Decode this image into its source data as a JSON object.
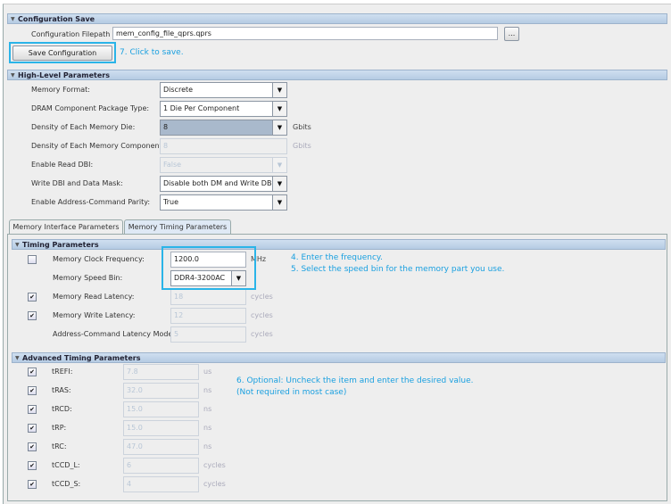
{
  "config_save": {
    "header": "Configuration Save",
    "filepath_label": "Configuration Filepath :",
    "filepath_value": "mem_config_file_qprs.qprs",
    "browse_label": "...",
    "save_button": "Save Configuration",
    "note": "7. Click to save."
  },
  "high_level": {
    "header": "High-Level Parameters",
    "rows": [
      {
        "label": "Memory Format:",
        "value": "Discrete",
        "unit": ""
      },
      {
        "label": "DRAM Component Package Type:",
        "value": "1 Die Per Component",
        "unit": ""
      },
      {
        "label": "Density of Each Memory Die:",
        "value": "8",
        "unit": "Gbits"
      },
      {
        "label": "Density of Each Memory Component :",
        "value": "8",
        "unit": "Gbits"
      },
      {
        "label": "Enable Read DBI:",
        "value": "False",
        "unit": ""
      },
      {
        "label": "Write DBI and Data Mask:",
        "value": "Disable both DM and Write DBI",
        "unit": ""
      },
      {
        "label": "Enable Address-Command Parity:",
        "value": "True",
        "unit": ""
      }
    ]
  },
  "tabs": [
    "Memory Interface Parameters",
    "Memory Timing Parameters"
  ],
  "timing": {
    "header": "Timing Parameters",
    "rows": [
      {
        "label": "Memory Clock Frequency:",
        "value": "1200.0",
        "unit": "MHz",
        "checked": false
      },
      {
        "label": "Memory Speed Bin:",
        "value": "DDR4-3200AC",
        "unit": ""
      },
      {
        "label": "Memory Read Latency:",
        "value": "18",
        "unit": "cycles",
        "checked": true
      },
      {
        "label": "Memory Write Latency:",
        "value": "12",
        "unit": "cycles",
        "checked": true
      },
      {
        "label": "Address-Command Latency Mode:",
        "value": "5",
        "unit": "cycles"
      }
    ],
    "note1": "4. Enter the frequency.",
    "note2": "5. Select the speed bin for the memory part you use."
  },
  "advanced": {
    "header": "Advanced Timing Parameters",
    "rows": [
      {
        "label": "tREFI:",
        "value": "7.8",
        "unit": "us"
      },
      {
        "label": "tRAS:",
        "value": "32.0",
        "unit": "ns"
      },
      {
        "label": "tRCD:",
        "value": "15.0",
        "unit": "ns"
      },
      {
        "label": "tRP:",
        "value": "15.0",
        "unit": "ns"
      },
      {
        "label": "tRC:",
        "value": "47.0",
        "unit": "ns"
      },
      {
        "label": "tCCD_L:",
        "value": "6",
        "unit": "cycles"
      },
      {
        "label": "tCCD_S:",
        "value": "4",
        "unit": "cycles"
      }
    ],
    "note1": "6. Optional: Uncheck the item and enter the desired value.",
    "note2": "(Not required in most case)"
  },
  "checkmark": "✔"
}
